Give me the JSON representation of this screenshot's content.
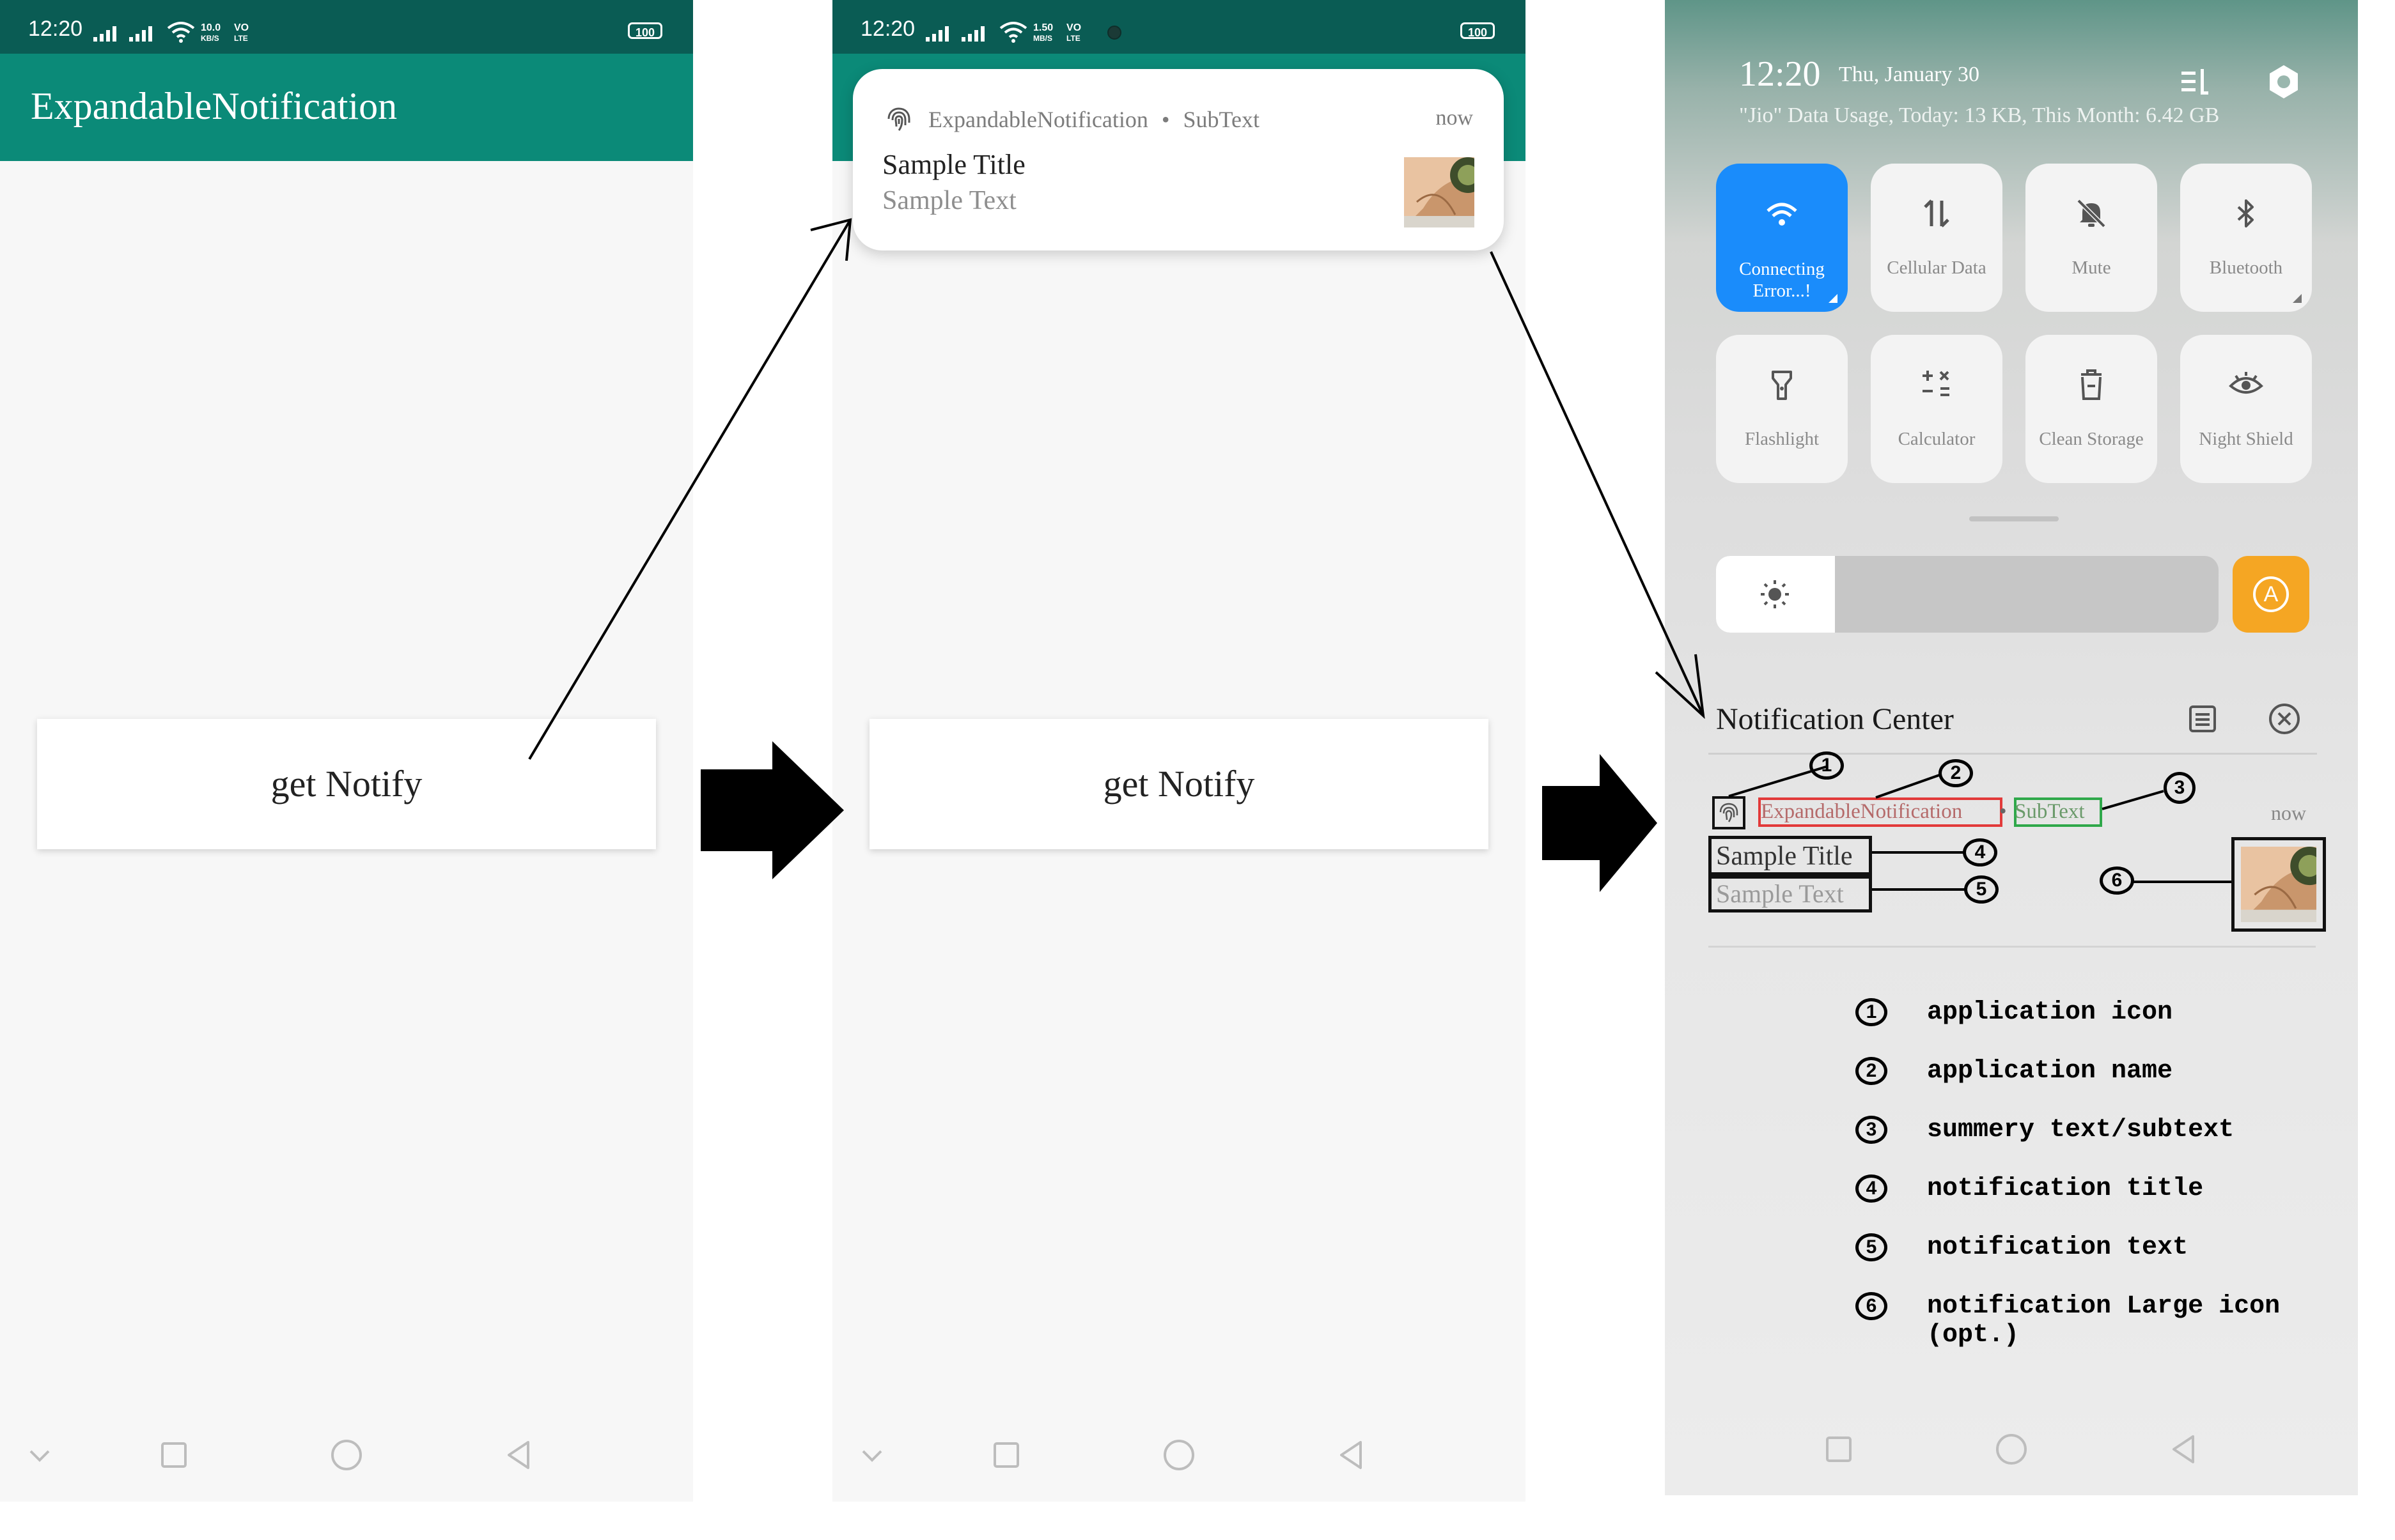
{
  "status_bar": {
    "time": "12:20",
    "screen1_speed": [
      "10.0",
      "KB/S"
    ],
    "screen2_speed": [
      "1.50",
      "MB/S"
    ],
    "network_tag": [
      "VO",
      "LTE"
    ],
    "battery": "100"
  },
  "app": {
    "title": "ExpandableNotification",
    "button_label": "get Notify"
  },
  "heads_up": {
    "app_name": "ExpandableNotification",
    "separator": "•",
    "subtext": "SubText",
    "time": "now",
    "title": "Sample Title",
    "text": "Sample Text"
  },
  "control_center": {
    "time": "12:20",
    "date": "Thu, January 30",
    "data_usage": "\"Jio\" Data Usage, Today: 13 KB, This Month: 6.42 GB",
    "tiles": [
      {
        "label": "Connecting Error...!",
        "icon": "wifi-icon",
        "active": true
      },
      {
        "label": "Cellular Data",
        "icon": "cellular-data-icon",
        "active": false
      },
      {
        "label": "Mute",
        "icon": "mute-icon",
        "active": false
      },
      {
        "label": "Bluetooth",
        "icon": "bluetooth-icon",
        "active": false
      },
      {
        "label": "Flashlight",
        "icon": "flashlight-icon",
        "active": false
      },
      {
        "label": "Calculator",
        "icon": "calculator-icon",
        "active": false
      },
      {
        "label": "Clean Storage",
        "icon": "clean-storage-icon",
        "active": false
      },
      {
        "label": "Night Shield",
        "icon": "night-shield-icon",
        "active": false
      }
    ],
    "auto_brightness_label": "A",
    "notification_center_title": "Notification Center",
    "notification": {
      "app_name": "ExpandableNotification",
      "separator": "•",
      "subtext": "SubText",
      "time": "now",
      "title": "Sample Title",
      "text": "Sample Text"
    }
  },
  "annotations": {
    "numbers": [
      "1",
      "2",
      "3",
      "4",
      "5",
      "6"
    ],
    "legend": [
      {
        "num": "1",
        "label": "application icon"
      },
      {
        "num": "2",
        "label": "application name"
      },
      {
        "num": "3",
        "label": "summery text/subtext"
      },
      {
        "num": "4",
        "label": "notification title"
      },
      {
        "num": "5",
        "label": "notification text"
      },
      {
        "num": "6",
        "label": "notification Large icon (opt.)"
      }
    ]
  },
  "colors": {
    "status_bar": "#0a5c54",
    "app_bar": "#0b8a78",
    "tile_active": "#1a8cfb",
    "auto_brightness": "#f5a623",
    "annotation_red": "#e23a3a",
    "annotation_green": "#2fa84a"
  }
}
